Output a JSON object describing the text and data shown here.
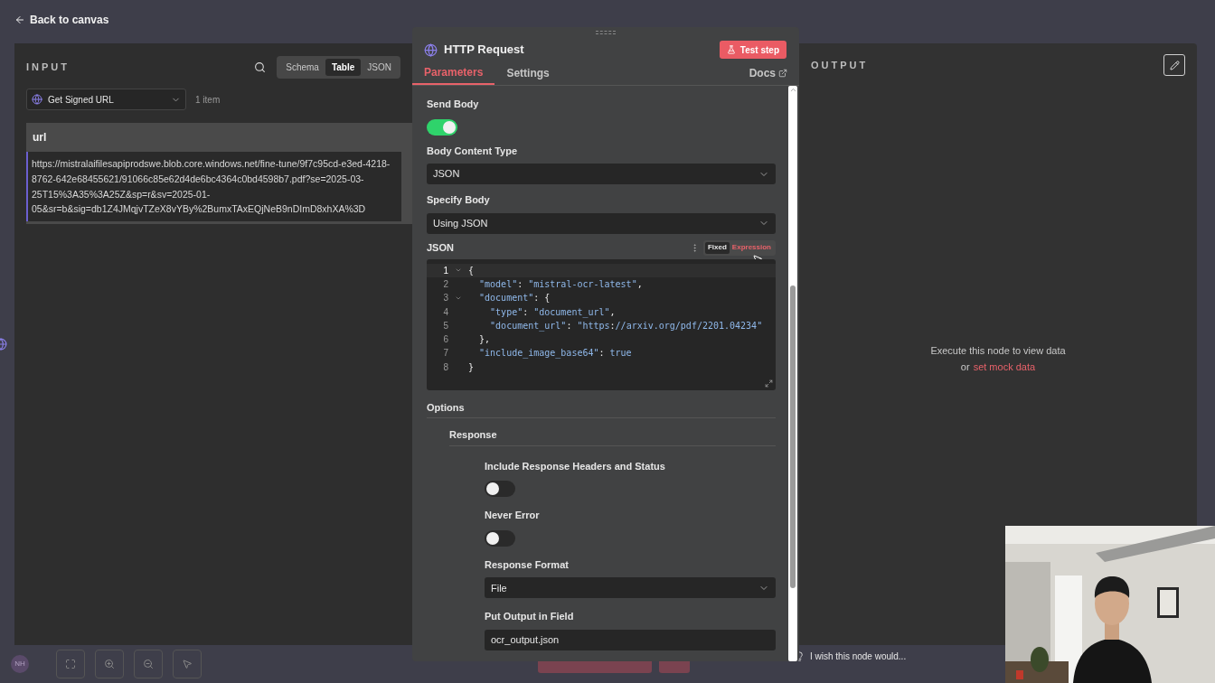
{
  "top_bar": {
    "back_link": "Back to canvas"
  },
  "input_panel": {
    "title": "INPUT",
    "view_tabs": [
      {
        "label": "Schema",
        "selected": false
      },
      {
        "label": "Table",
        "selected": true
      },
      {
        "label": "JSON",
        "selected": false
      }
    ],
    "node_select": {
      "value": "Get Signed URL"
    },
    "item_count": "1 item",
    "table": {
      "columns": [
        "url"
      ],
      "rows": [
        [
          "https://mistralaifilesapiprodswe.blob.core.windows.net/fine-tune/9f7c95cd-e3ed-4218-8762-642e68455621/91066c85e62d4de6bc4364c0bd4598b7.pdf?se=2025-03-25T15%3A35%3A25Z&sp=r&sv=2025-01-05&sr=b&sig=db1Z4JMqjvTZeX8vYBy%2BumxTAxEQjNeB9nDImD8xhXA%3D"
        ]
      ]
    }
  },
  "node_panel": {
    "title": "HTTP Request",
    "test_button": "Test step",
    "tabs": [
      {
        "label": "Parameters",
        "selected": true
      },
      {
        "label": "Settings",
        "selected": false
      }
    ],
    "docs_link": "Docs",
    "fields": [
      {
        "kind": "toggle",
        "label": "Send Body",
        "on": true
      },
      {
        "kind": "select",
        "label": "Body Content Type",
        "value": "JSON"
      },
      {
        "kind": "select",
        "label": "Specify Body",
        "value": "Using JSON"
      }
    ],
    "json_editor": {
      "label": "JSON",
      "modes": [
        {
          "label": "Fixed",
          "selected": true
        },
        {
          "label": "Expression",
          "selected": false
        }
      ],
      "lines": [
        {
          "number": "1",
          "text": "{",
          "foldable": true,
          "active": true
        },
        {
          "number": "2",
          "text": "  \"model\": \"mistral-ocr-latest\",",
          "foldable": false,
          "active": false
        },
        {
          "number": "3",
          "text": "  \"document\": {",
          "foldable": true,
          "active": false
        },
        {
          "number": "4",
          "text": "    \"type\": \"document_url\",",
          "foldable": false,
          "active": false
        },
        {
          "number": "5",
          "text": "    \"document_url\": \"https://arxiv.org/pdf/2201.04234\"",
          "foldable": false,
          "active": false
        },
        {
          "number": "6",
          "text": "  },",
          "foldable": false,
          "active": false
        },
        {
          "number": "7",
          "text": "  \"include_image_base64\": true",
          "foldable": false,
          "active": false
        },
        {
          "number": "8",
          "text": "}",
          "foldable": false,
          "active": false
        }
      ]
    },
    "options": {
      "title": "Options",
      "group": "Response",
      "fields": [
        {
          "kind": "toggle",
          "label": "Include Response Headers and Status",
          "on": false
        },
        {
          "kind": "toggle",
          "label": "Never Error",
          "on": false
        },
        {
          "kind": "select",
          "label": "Response Format",
          "value": "File"
        },
        {
          "kind": "text",
          "label": "Put Output in Field",
          "value": "ocr_output.json"
        }
      ]
    }
  },
  "output_panel": {
    "title": "OUTPUT",
    "empty_message": "Execute this node to view data",
    "empty_prefix": "or",
    "mock_link": "set mock data"
  },
  "feedback": {
    "text": "I wish this node would..."
  },
  "avatar": {
    "initials": "NH"
  }
}
